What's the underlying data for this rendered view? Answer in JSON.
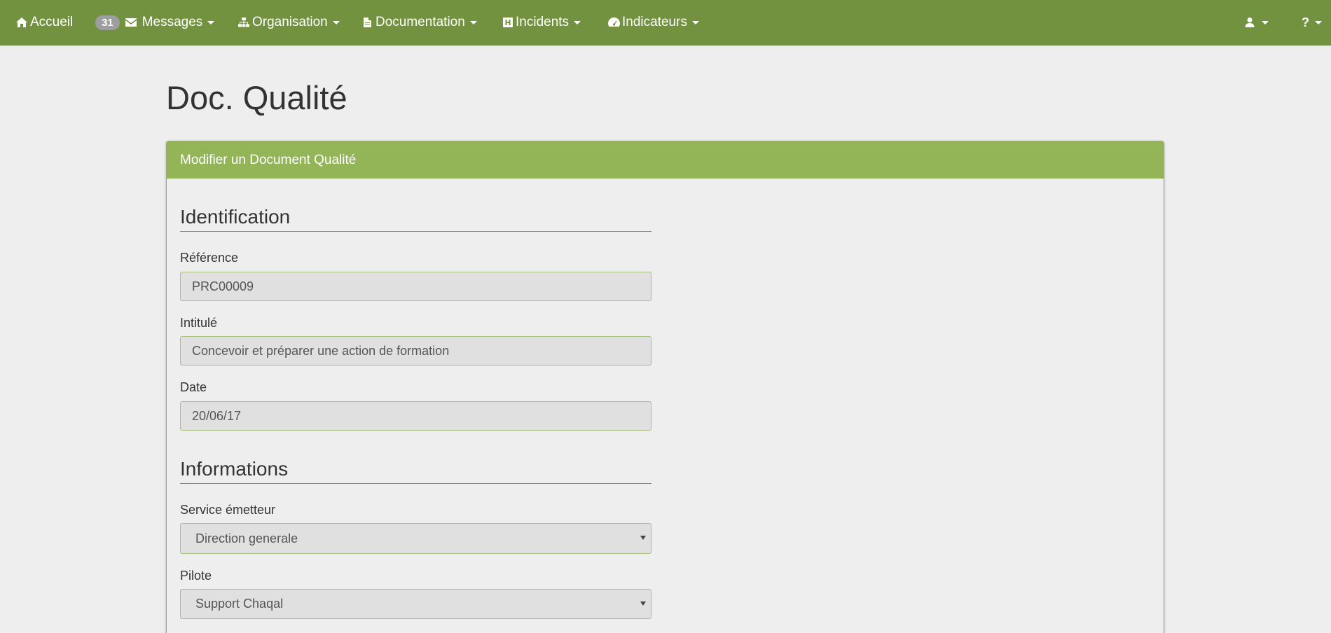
{
  "navbar": {
    "home_label": "Accueil",
    "messages_count": "31",
    "messages_label": "Messages",
    "organisation_label": "Organisation",
    "documentation_label": "Documentation",
    "incidents_label": "Incidents",
    "indicateurs_label": "Indicateurs",
    "help_label": "?"
  },
  "page": {
    "title": "Doc. Qualité"
  },
  "panel": {
    "heading": "Modifier un Document Qualité"
  },
  "sections": {
    "identification": "Identification",
    "informations": "Informations"
  },
  "fields": {
    "reference": {
      "label": "Référence",
      "value": "PRC00009"
    },
    "intitule": {
      "label": "Intitulé",
      "value": "Concevoir et préparer une action de formation"
    },
    "date": {
      "label": "Date",
      "value": "20/06/17"
    },
    "service": {
      "label": "Service émetteur",
      "value": "Direction generale"
    },
    "pilote": {
      "label": "Pilote",
      "value": "Support Chaqal"
    }
  },
  "colors": {
    "navbar": "#73923f",
    "panel_heading": "#93b558",
    "badge": "#9e9e9e",
    "background": "#eeeeee"
  }
}
